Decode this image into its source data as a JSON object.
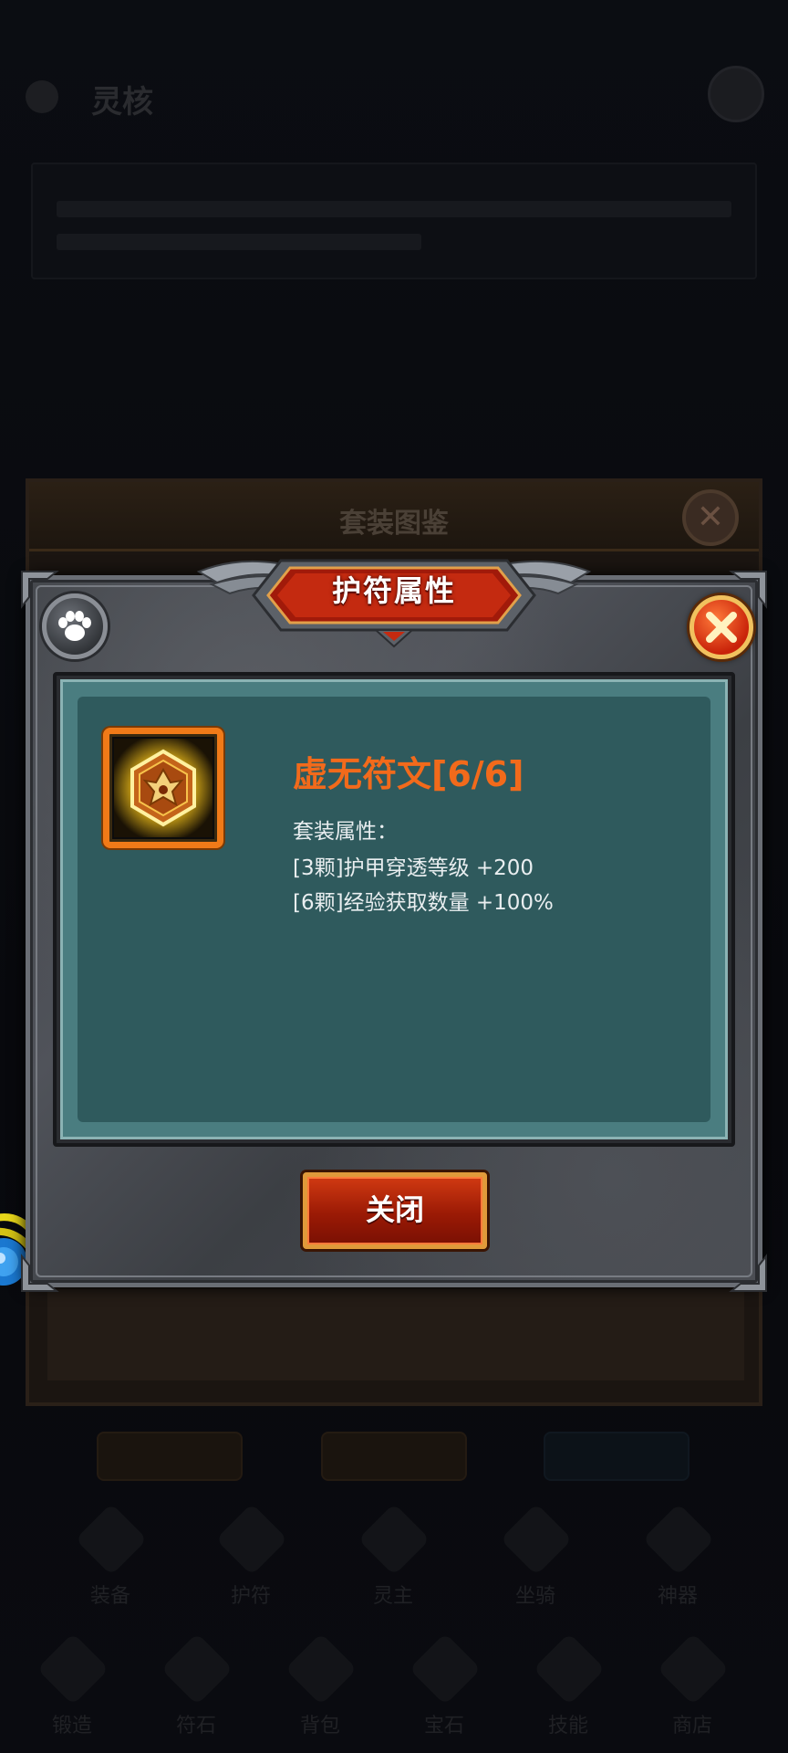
{
  "background": {
    "page_title": "灵核",
    "panel_title": "套装图鉴",
    "nav_top": [
      "装备",
      "护符",
      "灵主",
      "坐骑",
      "神器"
    ],
    "nav_bottom": [
      "锻造",
      "符石",
      "背包",
      "宝石",
      "技能",
      "商店"
    ]
  },
  "modal": {
    "title": "护符属性",
    "close_label": "关闭",
    "item": {
      "name": "虚无符文[6/6]",
      "icon": "void-rune-icon",
      "name_color": "#f26a1b"
    },
    "attributes": {
      "heading": "套装属性：",
      "lines": [
        "[3颗]护甲穿透等级 +200",
        "[6颗]经验获取数量 +100%"
      ]
    }
  },
  "colors": {
    "panel_teal": "#2f5a5d",
    "frame_orange": "#f07a18",
    "button_red": "#c9230a"
  }
}
